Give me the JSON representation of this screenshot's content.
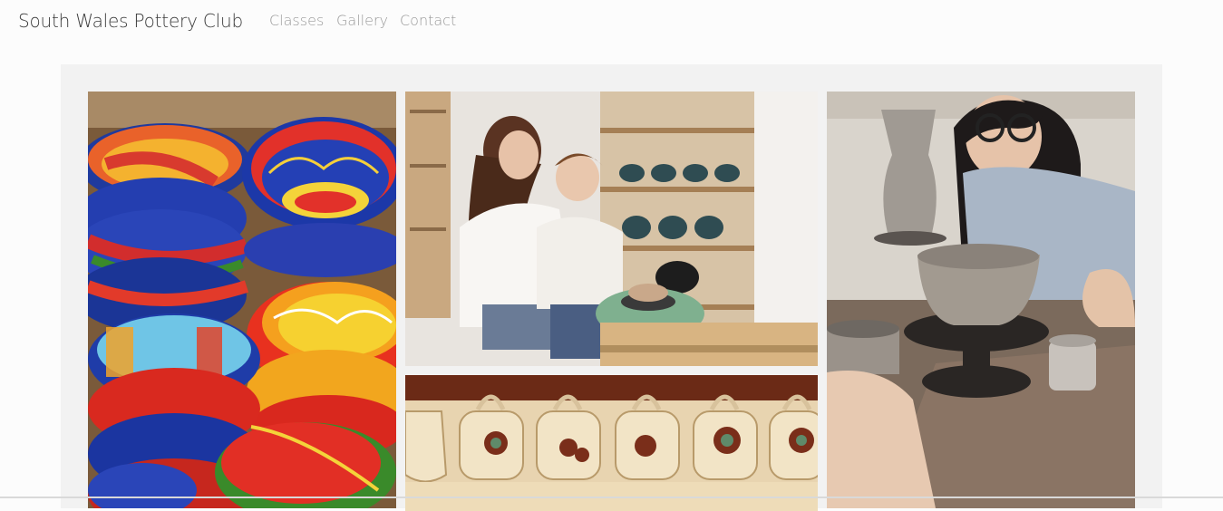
{
  "header": {
    "brand": "South Wales Pottery Club",
    "nav": [
      {
        "label": "Classes"
      },
      {
        "label": "Gallery"
      },
      {
        "label": "Contact"
      }
    ]
  },
  "gallery": {
    "images": [
      {
        "subject": "stacked colorful painted bowls"
      },
      {
        "subject": "mother and son at pottery wheel"
      },
      {
        "subject": "row of painted ceramic mugs on hooks"
      },
      {
        "subject": "woman shaping clay bowl on wheel"
      }
    ]
  },
  "colors": {
    "brand_text": "#3a3a3a",
    "nav_text": "#9a9a9a",
    "frame_bg": "#f2f2f2",
    "page_bg": "#fcfcfc"
  }
}
